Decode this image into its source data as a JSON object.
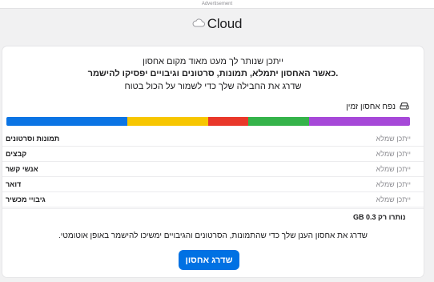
{
  "ad": {
    "label": "Advertisement"
  },
  "header": {
    "brand": "Cloud",
    "logo_icon": "cloud-icon"
  },
  "intro": {
    "line1": "ייתכן שנותר לך מעט מאוד מקום אחסון",
    "line2": ".כאשר האחסון יתמלא, תמונות, סרטונים וגיבויים יפסיקו להישמר",
    "line3": "שדרג את החבילה שלך כדי לשמור על הכול בטוח"
  },
  "storage": {
    "title": "נפח אחסון זמין",
    "icon": "hard-drive-icon",
    "segments": [
      {
        "name": "blue",
        "color": "#0b74e4",
        "fraction": 0.3
      },
      {
        "name": "yellow",
        "color": "#f7c600",
        "fraction": 0.2
      },
      {
        "name": "red",
        "color": "#e9382a",
        "fraction": 0.1
      },
      {
        "name": "green",
        "color": "#35b34a",
        "fraction": 0.15
      },
      {
        "name": "purple",
        "color": "#a648d8",
        "fraction": 0.25
      }
    ],
    "rows": [
      {
        "label": "תמונות וסרטונים",
        "value": "ייתכן שמלא"
      },
      {
        "label": "קבצים",
        "value": "ייתכן שמלא"
      },
      {
        "label": "אנשי קשר",
        "value": "ייתכן שמלא"
      },
      {
        "label": "דואר",
        "value": "ייתכן שמלא"
      },
      {
        "label": "גיבויי מכשיר",
        "value": "ייתכן שמלא"
      }
    ],
    "free_text": "GB 0.3 נותרו רק"
  },
  "footer": {
    "note": ".שדרג את אחסון הענן שלך כדי שהתמונות, הסרטונים והגיבויים ימשיכו להישמר באופן אוטומטי",
    "button_label": "שדרג אחסון"
  }
}
